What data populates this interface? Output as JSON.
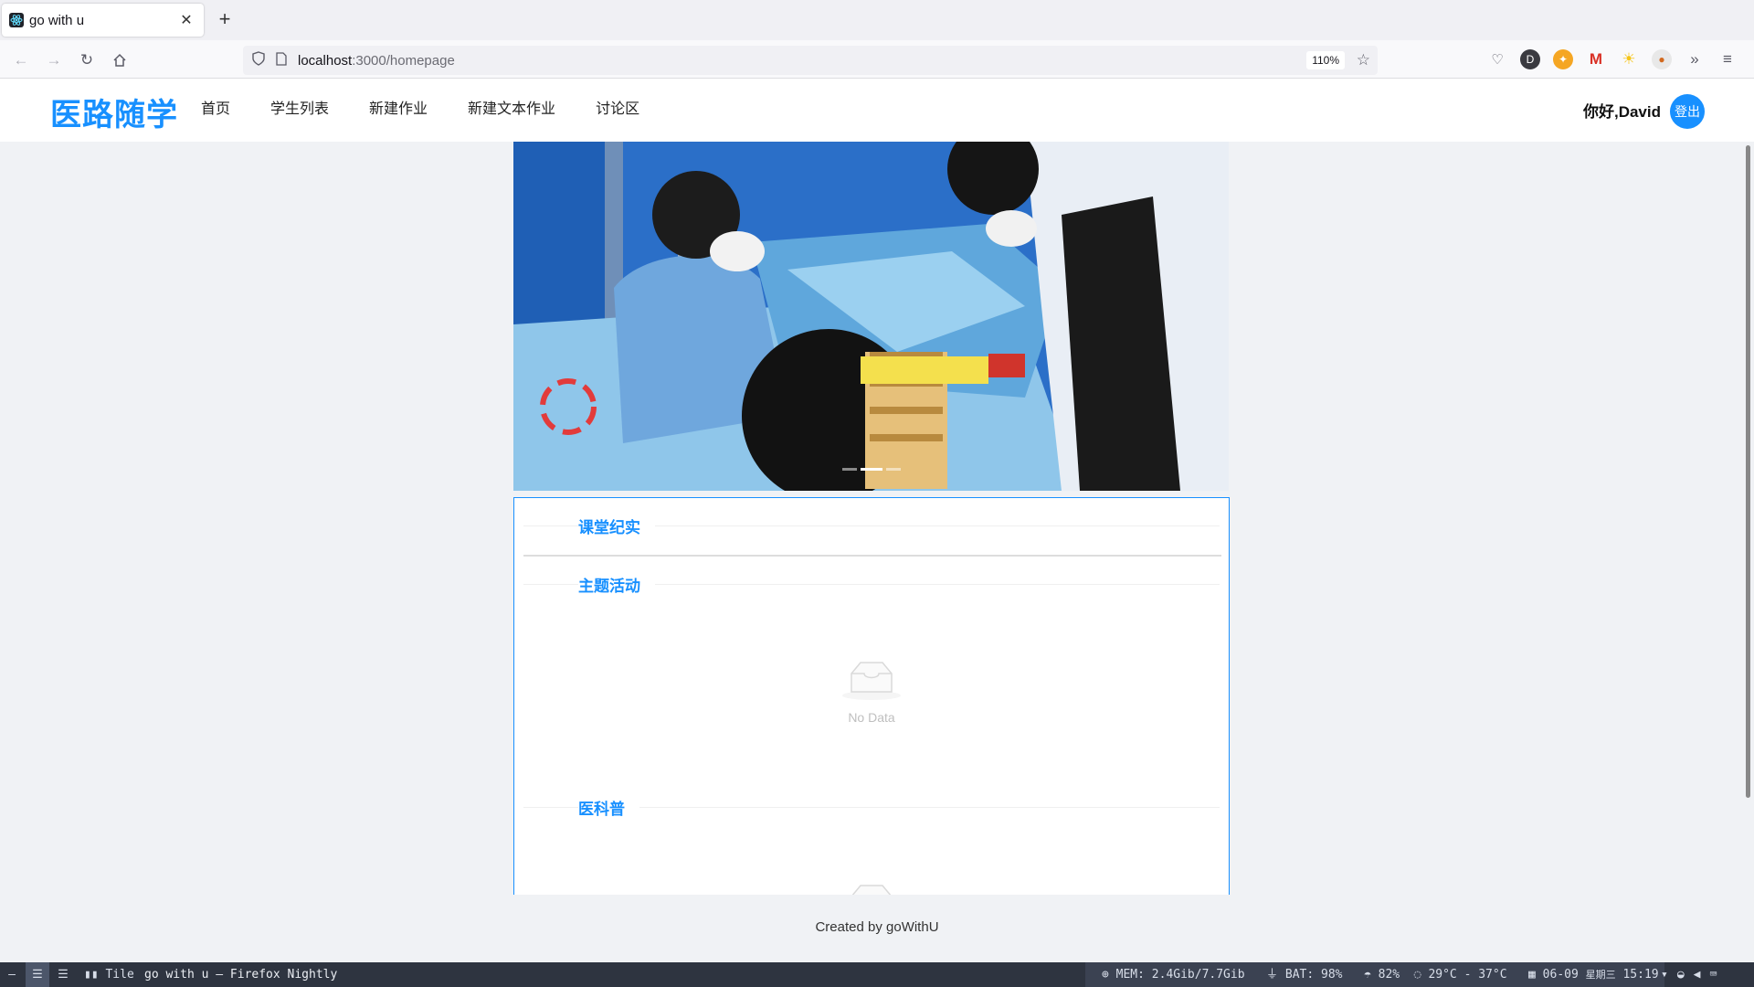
{
  "browser": {
    "tab_title": "go with u",
    "url_host": "localhost",
    "url_path": ":3000/homepage",
    "zoom": "110%"
  },
  "app": {
    "logo": "医路随学",
    "menu": [
      "首页",
      "学生列表",
      "新建作业",
      "新建文本作业",
      "讨论区"
    ],
    "greeting": "你好,David",
    "logout_label": "登出",
    "accent_color": "#1890ff"
  },
  "sections": [
    {
      "title": "课堂纪实"
    },
    {
      "title": "主题活动",
      "empty_text": "No Data"
    },
    {
      "title": "医科普"
    }
  ],
  "footer": "Created by goWithU",
  "taskbar": {
    "layout": "Tile",
    "window_title": "go with u — Firefox Nightly",
    "mem": "MEM: 2.4Gib/7.7Gib",
    "bat": "BAT: 98%",
    "brightness": "82%",
    "temp": "29°C - 37°C",
    "date": "06-09",
    "weekday": "星期三",
    "time": "15:19"
  }
}
